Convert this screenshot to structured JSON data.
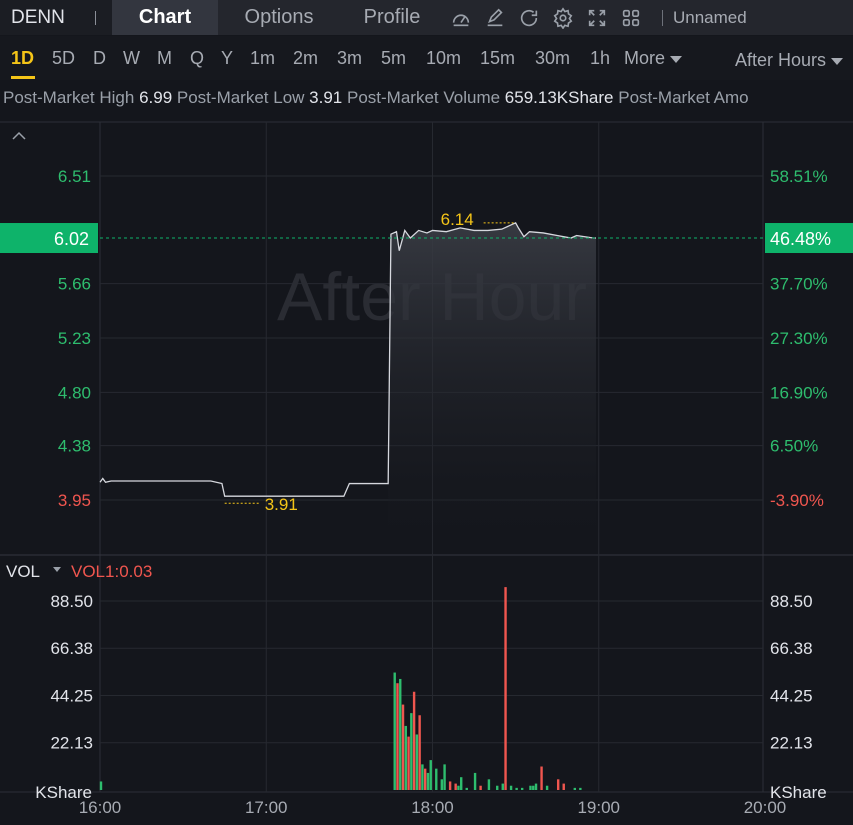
{
  "header": {
    "ticker": "DENN",
    "tabs": [
      "Chart",
      "Options",
      "Profile"
    ],
    "layout_name": "Unnamed"
  },
  "periods": [
    "1D",
    "5D",
    "D",
    "W",
    "M",
    "Q",
    "Y",
    "1m",
    "2m",
    "3m",
    "5m",
    "10m",
    "15m",
    "30m",
    "1h"
  ],
  "more_label": "More",
  "session_label": "After Hours",
  "stats": {
    "high_label": "Post-Market High",
    "high": "6.99",
    "low_label": "Post-Market Low",
    "low": "3.91",
    "volume_label": "Post-Market Volume",
    "volume": "659.13KShare",
    "amount_label": "Post-Market Amo"
  },
  "watermark": "After Hour",
  "colors": {
    "up": "#2ebd6e",
    "down": "#f0564f",
    "accent": "#f5c518",
    "current": "#0eb36a"
  },
  "chart_data": [
    {
      "type": "line",
      "title": "",
      "x_ticks": [
        "16:00",
        "17:00",
        "18:00",
        "19:00",
        "20:00"
      ],
      "y_ticks_left": [
        "6.51",
        "5.66",
        "5.23",
        "4.80",
        "4.38",
        "3.95"
      ],
      "y_ticks_right": [
        "58.51%",
        "37.70%",
        "27.30%",
        "16.90%",
        "6.50%",
        "-3.90%"
      ],
      "current_price": "6.02",
      "current_change": "46.48%",
      "high_marker": "6.14",
      "low_marker": "3.91",
      "ylim": [
        3.85,
        6.62
      ],
      "series": [
        {
          "x": [
            "16:00",
            "16:01",
            "16:02",
            "16:04",
            "16:10",
            "16:20",
            "16:30",
            "16:40",
            "16:44",
            "16:45",
            "16:48",
            "16:55",
            "17:00",
            "17:10",
            "17:20",
            "17:28",
            "17:30",
            "17:40",
            "17:44",
            "17:45",
            "17:47",
            "17:48",
            "17:50",
            "17:52",
            "17:55",
            "17:58",
            "18:00",
            "18:05",
            "18:10",
            "18:15",
            "18:20",
            "18:25",
            "18:30",
            "18:31",
            "18:33",
            "18:35",
            "18:40",
            "18:45",
            "18:50",
            "18:52",
            "18:55",
            "18:58",
            "18:59"
          ],
          "y": [
            4.09,
            4.12,
            4.09,
            4.1,
            4.1,
            4.1,
            4.1,
            4.1,
            4.08,
            3.98,
            3.98,
            3.98,
            3.98,
            3.98,
            3.98,
            3.98,
            4.08,
            4.08,
            4.08,
            6.05,
            6.07,
            5.92,
            6.08,
            6.02,
            6.08,
            6.06,
            6.08,
            6.07,
            6.1,
            6.08,
            6.08,
            6.09,
            6.14,
            6.1,
            6.03,
            6.07,
            6.06,
            6.04,
            6.02,
            6.04,
            6.03,
            6.02,
            6.02
          ]
        }
      ]
    },
    {
      "type": "bar",
      "title": "VOL",
      "indicator": "VOL1:0.03",
      "y_ticks": [
        "88.50",
        "66.38",
        "44.25",
        "22.13"
      ],
      "unit": "KShare",
      "ylim": [
        0,
        97
      ],
      "series": [
        {
          "x_minutes": [
            0,
            106,
            107,
            108,
            109,
            110,
            111,
            112,
            113,
            114,
            115,
            116,
            117,
            118,
            119,
            121,
            123,
            124,
            126,
            128,
            129,
            130,
            132,
            135,
            137,
            140,
            143,
            145,
            146,
            148,
            150,
            152,
            155,
            156,
            157,
            159,
            161,
            165,
            167,
            171,
            173
          ],
          "values": [
            4,
            55,
            50,
            52,
            40,
            30,
            25,
            36,
            46,
            26,
            35,
            12,
            10,
            8,
            14,
            10,
            5,
            12,
            4,
            3,
            2,
            6,
            1,
            8,
            2,
            5,
            2,
            3,
            95,
            2,
            1,
            1,
            2,
            2,
            3,
            11,
            2,
            5,
            3,
            1,
            1
          ],
          "directions": [
            "u",
            "u",
            "d",
            "u",
            "d",
            "u",
            "d",
            "u",
            "d",
            "u",
            "d",
            "u",
            "d",
            "u",
            "u",
            "u",
            "u",
            "u",
            "d",
            "d",
            "u",
            "u",
            "u",
            "u",
            "d",
            "u",
            "u",
            "u",
            "d",
            "u",
            "u",
            "u",
            "u",
            "u",
            "u",
            "d",
            "u",
            "d",
            "d",
            "u",
            "u"
          ]
        }
      ]
    }
  ]
}
